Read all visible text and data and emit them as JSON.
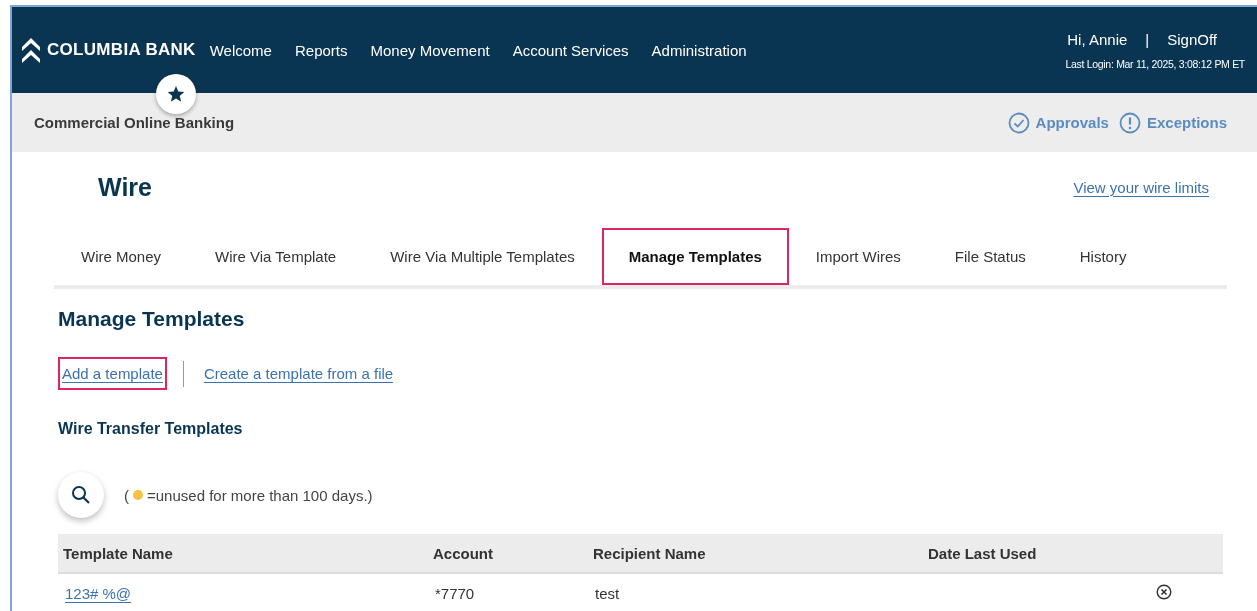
{
  "header": {
    "brand": "COLUMBIA BANK",
    "nav": [
      {
        "label": "Welcome"
      },
      {
        "label": "Reports"
      },
      {
        "label": "Money Movement"
      },
      {
        "label": "Account Services"
      },
      {
        "label": "Administration"
      }
    ],
    "greeting": "Hi, Annie",
    "separator": "|",
    "signoff": "SignOff",
    "last_login": "Last Login: Mar 11, 2025, 3:08:12 PM ET"
  },
  "subheader": {
    "title": "Commercial Online Banking",
    "links": [
      {
        "kind": "check",
        "label": "Approvals"
      },
      {
        "kind": "alert",
        "label": "Exceptions"
      }
    ]
  },
  "page": {
    "title": "Wire",
    "limits_link": "View your wire limits"
  },
  "tabs": [
    {
      "label": "Wire Money",
      "selected": false,
      "highlighted": false
    },
    {
      "label": "Wire Via Template",
      "selected": false,
      "highlighted": false
    },
    {
      "label": "Wire Via Multiple Templates",
      "selected": false,
      "highlighted": false
    },
    {
      "label": "Manage Templates",
      "selected": true,
      "highlighted": true
    },
    {
      "label": "Import Wires",
      "selected": false,
      "highlighted": false
    },
    {
      "label": "File Status",
      "selected": false,
      "highlighted": false
    },
    {
      "label": "History",
      "selected": false,
      "highlighted": false
    }
  ],
  "section": {
    "title": "Manage Templates",
    "actions": [
      {
        "label": "Add a template",
        "highlighted": true
      },
      {
        "label": "Create a template from a file",
        "highlighted": false
      }
    ],
    "subtitle": "Wire Transfer Templates"
  },
  "legend": {
    "open": "(",
    "color": "#f5c242",
    "text": "=unused for more than 100 days.)"
  },
  "table": {
    "columns": [
      "Template Name",
      "Account",
      "Recipient Name",
      "Date Last Used"
    ],
    "rows": [
      {
        "name": "123# %@",
        "account": "*7770",
        "recipient": "test"
      }
    ]
  }
}
